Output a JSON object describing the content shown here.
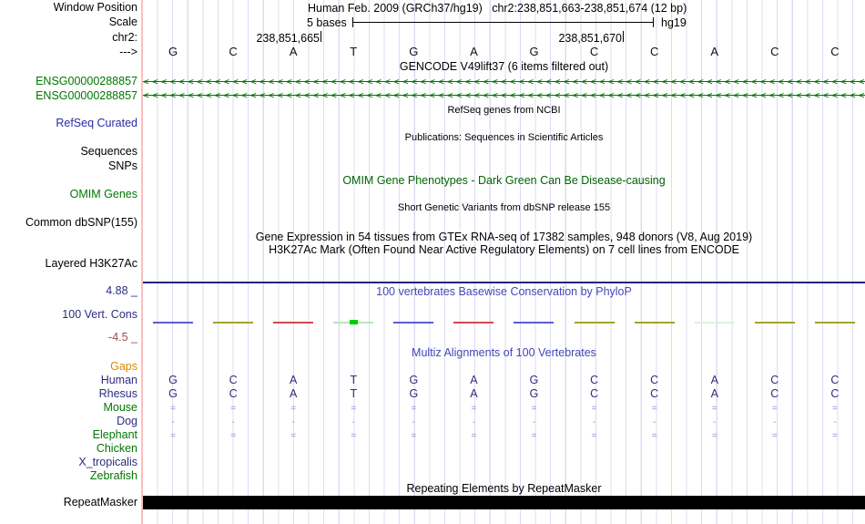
{
  "header": {
    "position_title": "Human Feb. 2009 (GRCh37/hg19)   chr2:238,851,663-238,851,674 (12 bp)",
    "scale_value": "5 bases",
    "genome_tag": "hg19",
    "coord_tick_left": "238,851,665",
    "coord_tick_right": "238,851,670"
  },
  "left_labels": {
    "window_position": "Window Position",
    "scale": "Scale",
    "chrom": "chr2:",
    "strand": "--->",
    "refseq": "RefSeq Curated",
    "sequences": "Sequences",
    "snps": "SNPs",
    "omim": "OMIM Genes",
    "dbsnp": "Common dbSNP(155)",
    "h3k27ac": "Layered H3K27Ac",
    "repeatmasker": "RepeatMasker"
  },
  "track_titles": {
    "gencode": "GENCODE V49lift37 (6 items filtered out)",
    "refseq": "RefSeq genes from NCBI",
    "publications": "Publications: Sequences in Scientific Articles",
    "omim": "OMIM Gene Phenotypes - Dark Green Can Be Disease-causing",
    "dbsnp": "Short Genetic Variants from dbSNP release 155",
    "gtex": "Gene Expression in 54 tissues from GTEx RNA-seq of 17382 samples, 948 donors (V8, Aug 2019)",
    "h3k27ac": "H3K27Ac Mark (Often Found Near Active Regulatory Elements) on 7 cell lines from ENCODE",
    "phylop": "100 vertebrates Basewise Conservation by PhyloP",
    "multiz": "Multiz Alignments of 100 Vertebrates",
    "repeatmasker": "Repeating Elements by RepeatMasker"
  },
  "gencode": {
    "arrow_char": "<",
    "gene_ids": [
      "ENSG00000288857",
      "ENSG00000288857"
    ]
  },
  "sequence": {
    "bases": [
      "G",
      "C",
      "A",
      "T",
      "G",
      "A",
      "G",
      "C",
      "C",
      "A",
      "C",
      "C"
    ]
  },
  "conservation": {
    "label": "100 Vert. Cons",
    "scale_max": "4.88 _",
    "scale_min": "-4.5 _",
    "segments": [
      {
        "color": "#5c5ccf"
      },
      {
        "color": "#a3a32e"
      },
      {
        "color": "#d04a4a"
      },
      {
        "color": "#b9e8b9",
        "center_color": "#00cc00"
      },
      {
        "color": "#5c5ccf"
      },
      {
        "color": "#d04a4a"
      },
      {
        "color": "#5c5ccf"
      },
      {
        "color": "#a3a32e"
      },
      {
        "color": "#a3a32e"
      },
      {
        "color": "#ddf2dd"
      },
      {
        "color": "#a3a32e"
      },
      {
        "color": "#a3a32e"
      }
    ]
  },
  "alignment": {
    "gaps_label": "Gaps",
    "rows": {
      "human": {
        "label": "Human",
        "cells": [
          "G",
          "C",
          "A",
          "T",
          "G",
          "A",
          "G",
          "C",
          "C",
          "A",
          "C",
          "C"
        ]
      },
      "rhesus": {
        "label": "Rhesus",
        "cells": [
          "G",
          "C",
          "A",
          "T",
          "G",
          "A",
          "G",
          "C",
          "C",
          "A",
          "C",
          "C"
        ]
      },
      "mouse": {
        "label": "Mouse",
        "cells": [
          "=",
          "=",
          "=",
          "=",
          "=",
          "=",
          "=",
          "=",
          "=",
          "=",
          "=",
          "="
        ]
      },
      "dog": {
        "label": "Dog",
        "cells": [
          "-",
          "-",
          "-",
          "-",
          "-",
          "-",
          "-",
          "-",
          "-",
          "-",
          "-",
          "-"
        ]
      },
      "elephant": {
        "label": "Elephant",
        "cells": [
          "=",
          "=",
          "=",
          "=",
          "=",
          "=",
          "=",
          "=",
          "=",
          "=",
          "=",
          "="
        ]
      },
      "chicken": {
        "label": "Chicken"
      },
      "x_tropicalis": {
        "label": "X_tropicalis"
      },
      "zebrafish": {
        "label": "Zebrafish"
      }
    }
  },
  "colors": {
    "gene_green": "#007700",
    "omim_dark_green": "#006400",
    "title_blue": "#4545bb",
    "species_navy": "#2d2d7f",
    "gaps_orange": "#d98a00",
    "scale_min_maroon": "#9e4b4b",
    "align_mark_periwinkle": "#9090d0",
    "grid_line": "#dcdcf2",
    "edge_pink": "#ffbdbd",
    "repeat_bar_black": "#000000"
  }
}
